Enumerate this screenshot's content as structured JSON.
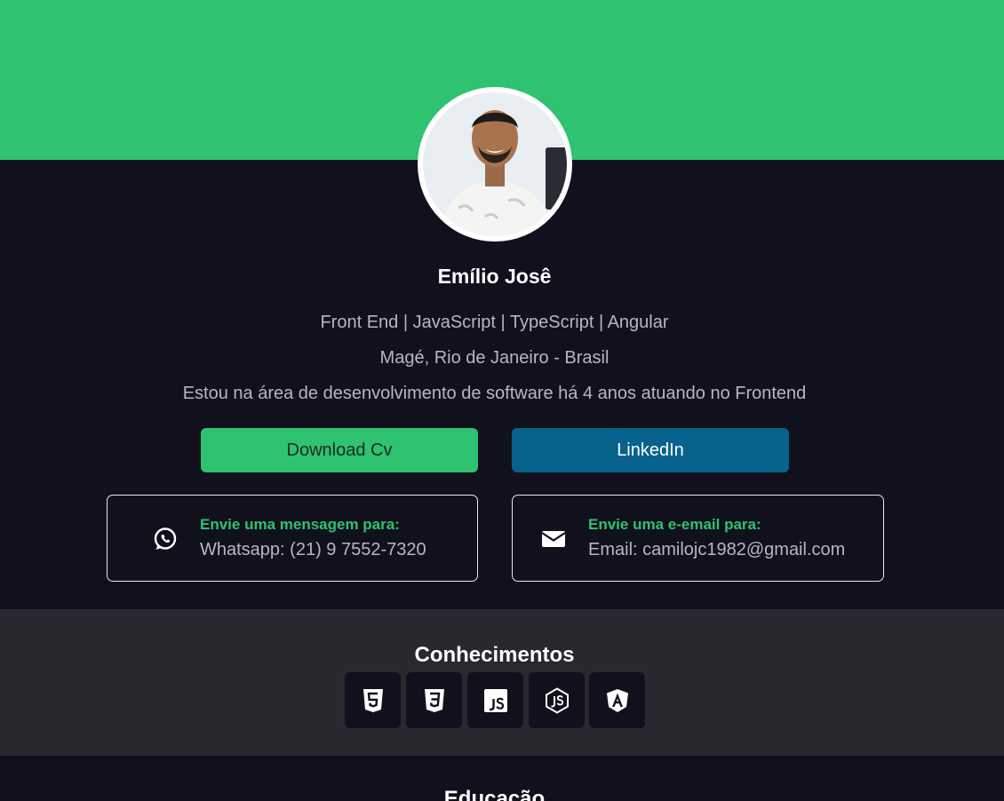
{
  "profile": {
    "name": "Emílio Josê",
    "headline": "Front End | JavaScript | TypeScript | Angular",
    "location": "Magé, Rio de Janeiro - Brasil",
    "bio": "Estou na área de desenvolvimento de software há 4 anos atuando no Frontend"
  },
  "actions": {
    "download_cv": "Download Cv",
    "linkedin": "LinkedIn"
  },
  "contacts": {
    "whatsapp": {
      "label": "Envie uma mensagem para:",
      "value": "Whatsapp: (21) 9 7552-7320",
      "icon": "whatsapp-icon"
    },
    "email": {
      "label": "Envie uma e-email para:",
      "value": "Email: camilojc1982@gmail.com",
      "icon": "envelope-icon"
    }
  },
  "skills": {
    "title": "Conhecimentos",
    "items": [
      {
        "icon": "html5-icon"
      },
      {
        "icon": "css3-icon"
      },
      {
        "icon": "javascript-icon"
      },
      {
        "icon": "nodejs-icon"
      },
      {
        "icon": "angular-icon"
      }
    ]
  },
  "education": {
    "title": "Educação"
  },
  "colors": {
    "accent": "#2ec271",
    "linkedin": "#07628d",
    "background": "#11111d",
    "section": "#29282f"
  }
}
